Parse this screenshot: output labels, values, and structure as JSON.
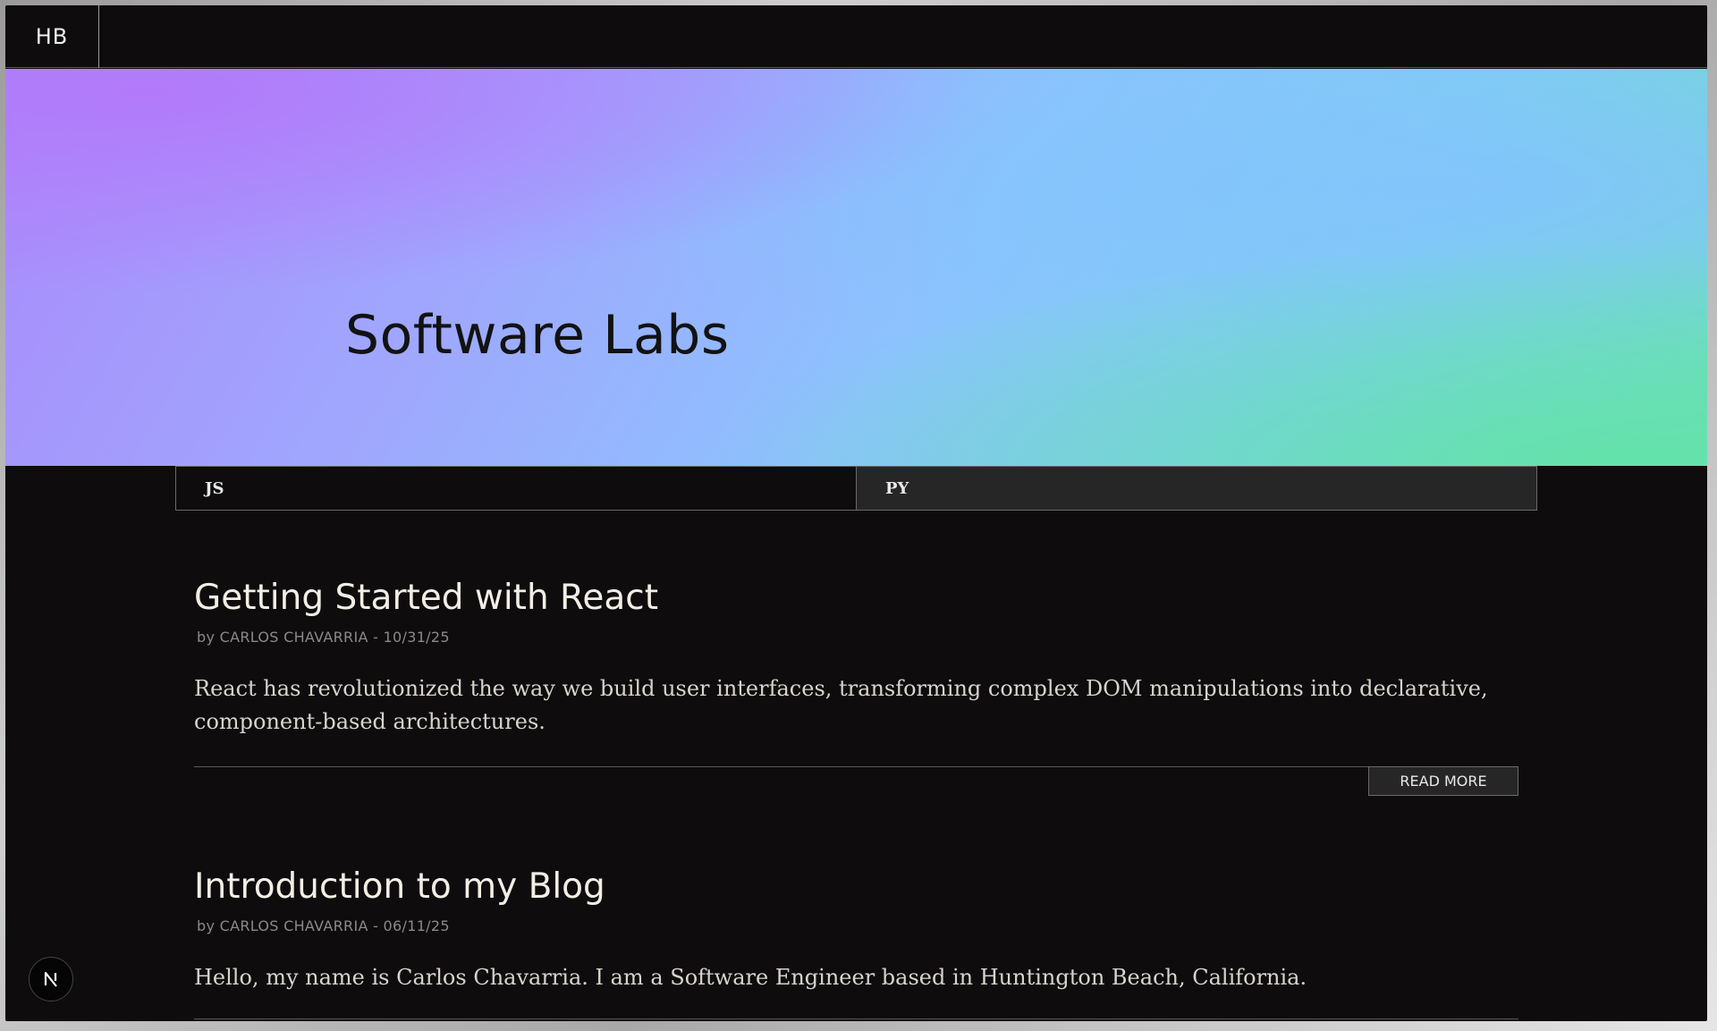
{
  "header": {
    "logo_text": "HB"
  },
  "hero": {
    "title": "Software Labs"
  },
  "tabs": [
    {
      "label": "JS",
      "active": true
    },
    {
      "label": "PY",
      "active": false
    }
  ],
  "posts": [
    {
      "title": "Getting Started with React",
      "meta": "by CARLOS CHAVARRIA - 10/31/25",
      "excerpt": "React has revolutionized the way we build user interfaces, transforming complex DOM manipulations into declarative, component-based architectures.",
      "read_more_label": "READ MORE"
    },
    {
      "title": "Introduction to my Blog",
      "meta": "by CARLOS CHAVARRIA - 06/11/25",
      "excerpt": "Hello, my name is Carlos Chavarria. I am a Software Engineer based in Huntington Beach, California."
    }
  ],
  "dev_badge": {
    "icon": "nextjs-icon",
    "letter": "N"
  }
}
